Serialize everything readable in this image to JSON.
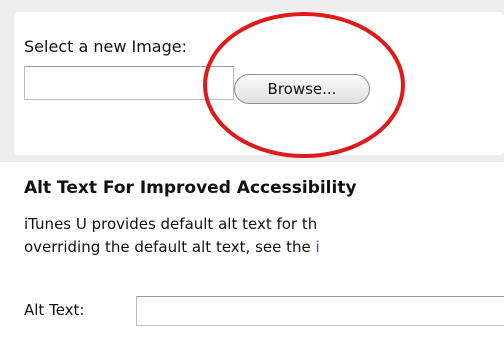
{
  "image_section": {
    "label": "Select a new Image:",
    "file_input_value": "",
    "browse_label": "Browse...",
    "highlight_color": "#e0191b"
  },
  "alt_text_section": {
    "title": "Alt Text For Improved Accessibility",
    "description_line1": "iTunes U provides default alt text for th",
    "description_line2_prefix": "overriding the default alt text, see the ",
    "description_link_fragment": "i",
    "field_label": "Alt Text:",
    "field_value": ""
  },
  "colors": {
    "panel_background": "#ededed",
    "link": "#6a2ad8"
  }
}
